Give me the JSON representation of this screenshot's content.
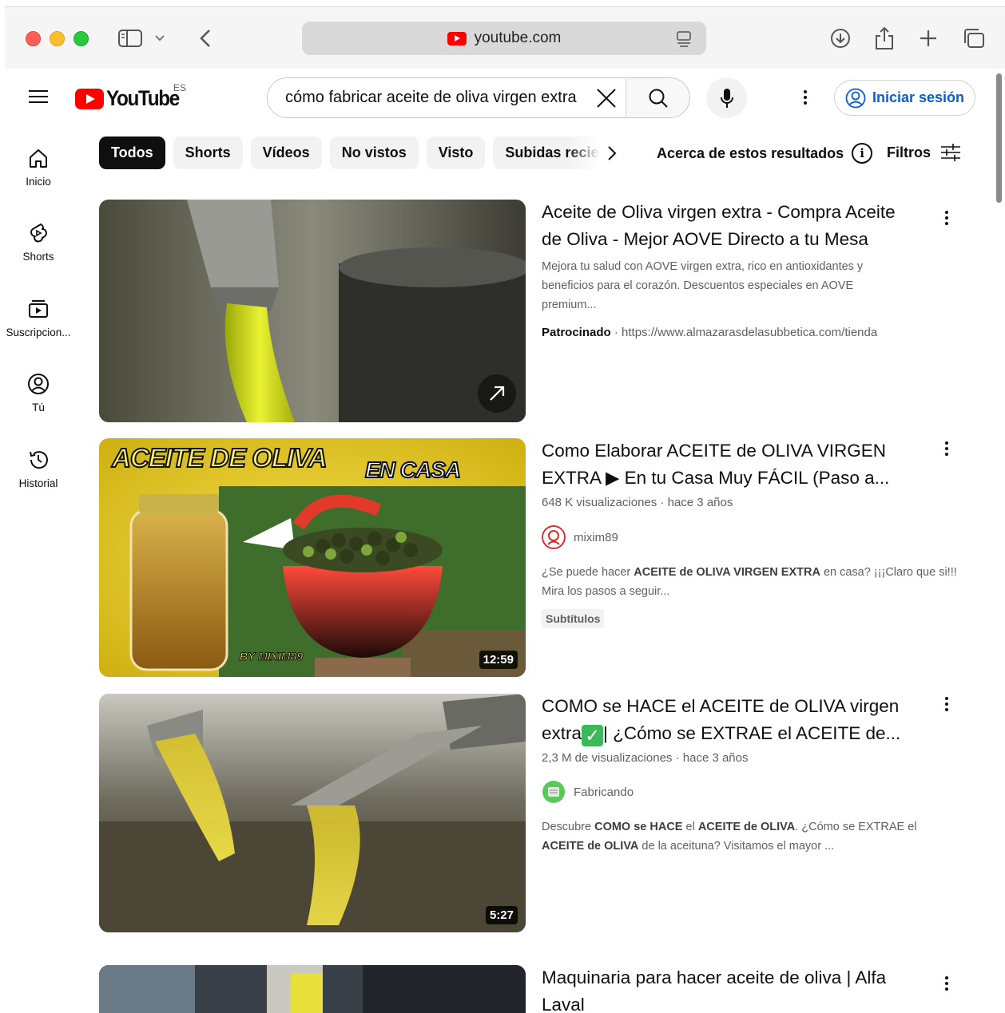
{
  "browser": {
    "url": "youtube.com"
  },
  "header": {
    "logo_text": "YouTube",
    "region": "ES",
    "search_value": "cómo fabricar aceite de oliva virgen extra",
    "signin_label": "Iniciar sesión"
  },
  "sidebar": {
    "items": [
      {
        "label": "Inicio",
        "icon": "home-icon"
      },
      {
        "label": "Shorts",
        "icon": "shorts-icon"
      },
      {
        "label": "Suscripcion...",
        "icon": "subscriptions-icon"
      },
      {
        "label": "Tú",
        "icon": "you-icon"
      },
      {
        "label": "Historial",
        "icon": "history-icon"
      }
    ]
  },
  "chips": [
    "Todos",
    "Shorts",
    "Vídeos",
    "No vistos",
    "Visto",
    "Subidas recien"
  ],
  "toolbar": {
    "about_label": "Acerca de estos resultados",
    "filters_label": "Filtros"
  },
  "results": [
    {
      "title": "Aceite de Oliva virgen extra - Compra Aceite de Oliva - Mejor AOVE Directo a tu Mesa",
      "description": "Mejora tu salud con AOVE virgen extra, rico en antioxidantes y beneficios para el corazón. Descuentos especiales en AOVE premium...",
      "sponsored_label": "Patrocinado",
      "sponsored_url": "https://www.almazarasdelasubbetica.com/tienda"
    },
    {
      "title": "Como Elaborar ACEITE de OLIVA VIRGEN EXTRA ▶ En tu Casa Muy FÁCIL (Paso a...",
      "views": "648 K visualizaciones",
      "age": "hace 3 años",
      "channel": "mixim89",
      "desc_parts": [
        "¿Se puede hacer ",
        "ACEITE de OLIVA VIRGEN EXTRA",
        " en casa? ¡¡¡Claro que si!!! Mira los pasos a seguir..."
      ],
      "badge": "Subtítulos",
      "duration": "12:59",
      "thumb_text_1": "ACEITE DE OLIVA",
      "thumb_text_2": "EN CASA",
      "thumb_text_3": "BY MIXIM89"
    },
    {
      "title_part_1": "COMO se HACE el ACEITE de OLIVA virgen extra",
      "title_check": "✓",
      "title_part_2": "| ¿Cómo se EXTRAE el ACEITE de...",
      "views": "2,3 M de visualizaciones",
      "age": "hace 3 años",
      "channel": "Fabricando",
      "desc_parts": [
        "Descubre ",
        "COMO se HACE",
        " el ",
        "ACEITE de OLIVA",
        ". ¿Cómo se EXTRAE el ",
        "ACEITE de OLIVA",
        " de la aceituna? Visitamos el mayor ..."
      ],
      "duration": "5:27"
    },
    {
      "title": "Maquinaria para hacer aceite de oliva | Alfa Laval"
    }
  ]
}
